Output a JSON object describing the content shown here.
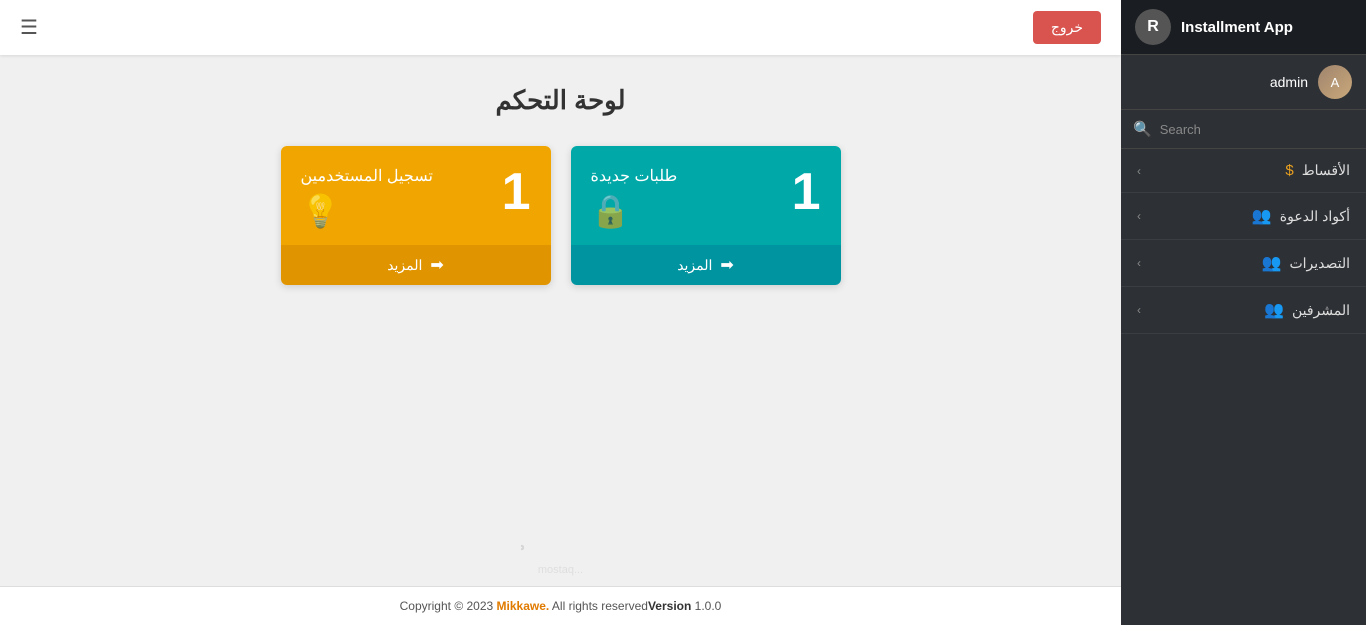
{
  "sidebar": {
    "app_title": "Installment App",
    "logo_letter": "R",
    "user": {
      "name": "admin",
      "avatar_text": "A"
    },
    "search": {
      "placeholder": "Search"
    },
    "nav_items": [
      {
        "id": "installments",
        "label": "الأقساط",
        "icon": "dollar",
        "chevron": "‹"
      },
      {
        "id": "invite-codes",
        "label": "أكواد الدعوة",
        "icon": "users",
        "chevron": "‹"
      },
      {
        "id": "exports",
        "label": "التصديرات",
        "icon": "users",
        "chevron": "‹"
      },
      {
        "id": "supervisors",
        "label": "المشرفين",
        "icon": "users",
        "chevron": "‹"
      }
    ]
  },
  "topbar": {
    "logout_label": "خروج",
    "hamburger": "☰"
  },
  "page": {
    "title": "لوحة التحكم",
    "cards": [
      {
        "id": "new-requests",
        "number": "1",
        "label": "طلبات جديدة",
        "icon": "🔒",
        "theme": "teal",
        "more_label": "المزيد"
      },
      {
        "id": "user-registrations",
        "number": "1",
        "label": "تسجيل المستخدمين",
        "icon": "💡",
        "theme": "yellow",
        "more_label": "المزيد"
      }
    ]
  },
  "footer": {
    "copyright": "Copyright © 2023 ",
    "brand": "Mikkawe.",
    "rights": " All rights reserved",
    "version_label": "Version",
    "version_number": "1.0.0"
  }
}
